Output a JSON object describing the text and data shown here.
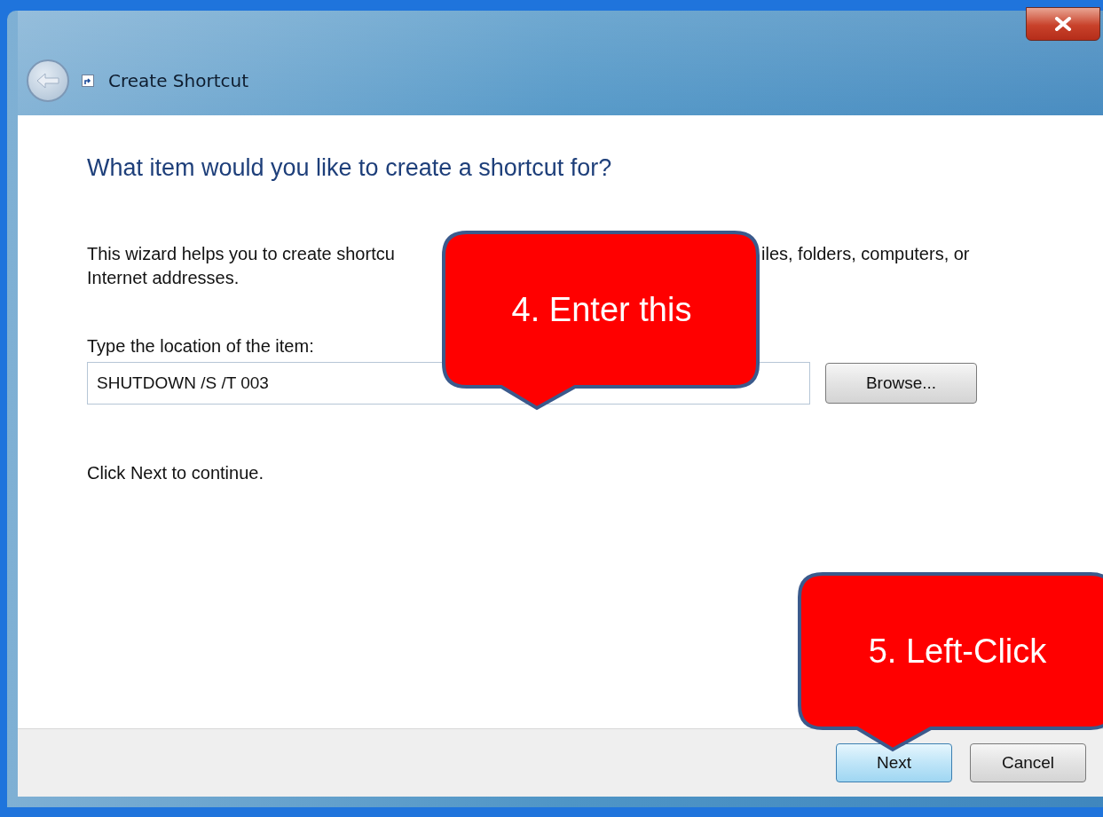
{
  "window": {
    "title": "Create Shortcut"
  },
  "heading": "What item would you like to create a shortcut for?",
  "description": {
    "line_1_start": "This wizard helps you to create shortcu",
    "line_1_end": "iles, folders, computers, or",
    "line_2": "Internet addresses."
  },
  "location": {
    "label": "Type the location of the item:",
    "value": "SHUTDOWN /S /T 003"
  },
  "browse_button": "Browse...",
  "hint": "Click Next to continue.",
  "buttons": [
    {
      "label": "Next",
      "kind": "default"
    },
    {
      "label": "Cancel",
      "kind": "normal"
    }
  ],
  "callouts": [
    {
      "text": "4.  Enter this"
    },
    {
      "text": "5.  Left-Click"
    }
  ]
}
